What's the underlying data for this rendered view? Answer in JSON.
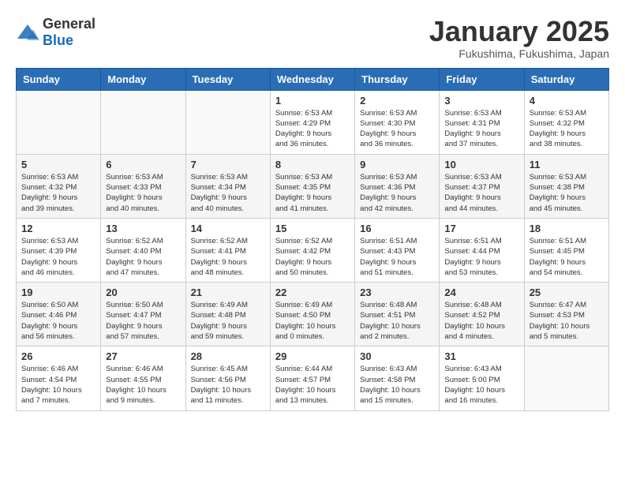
{
  "logo": {
    "general": "General",
    "blue": "Blue"
  },
  "title": "January 2025",
  "subtitle": "Fukushima, Fukushima, Japan",
  "days_of_week": [
    "Sunday",
    "Monday",
    "Tuesday",
    "Wednesday",
    "Thursday",
    "Friday",
    "Saturday"
  ],
  "weeks": [
    [
      {
        "day": "",
        "info": ""
      },
      {
        "day": "",
        "info": ""
      },
      {
        "day": "",
        "info": ""
      },
      {
        "day": "1",
        "info": "Sunrise: 6:53 AM\nSunset: 4:29 PM\nDaylight: 9 hours\nand 36 minutes."
      },
      {
        "day": "2",
        "info": "Sunrise: 6:53 AM\nSunset: 4:30 PM\nDaylight: 9 hours\nand 36 minutes."
      },
      {
        "day": "3",
        "info": "Sunrise: 6:53 AM\nSunset: 4:31 PM\nDaylight: 9 hours\nand 37 minutes."
      },
      {
        "day": "4",
        "info": "Sunrise: 6:53 AM\nSunset: 4:32 PM\nDaylight: 9 hours\nand 38 minutes."
      }
    ],
    [
      {
        "day": "5",
        "info": "Sunrise: 6:53 AM\nSunset: 4:32 PM\nDaylight: 9 hours\nand 39 minutes."
      },
      {
        "day": "6",
        "info": "Sunrise: 6:53 AM\nSunset: 4:33 PM\nDaylight: 9 hours\nand 40 minutes."
      },
      {
        "day": "7",
        "info": "Sunrise: 6:53 AM\nSunset: 4:34 PM\nDaylight: 9 hours\nand 40 minutes."
      },
      {
        "day": "8",
        "info": "Sunrise: 6:53 AM\nSunset: 4:35 PM\nDaylight: 9 hours\nand 41 minutes."
      },
      {
        "day": "9",
        "info": "Sunrise: 6:53 AM\nSunset: 4:36 PM\nDaylight: 9 hours\nand 42 minutes."
      },
      {
        "day": "10",
        "info": "Sunrise: 6:53 AM\nSunset: 4:37 PM\nDaylight: 9 hours\nand 44 minutes."
      },
      {
        "day": "11",
        "info": "Sunrise: 6:53 AM\nSunset: 4:38 PM\nDaylight: 9 hours\nand 45 minutes."
      }
    ],
    [
      {
        "day": "12",
        "info": "Sunrise: 6:53 AM\nSunset: 4:39 PM\nDaylight: 9 hours\nand 46 minutes."
      },
      {
        "day": "13",
        "info": "Sunrise: 6:52 AM\nSunset: 4:40 PM\nDaylight: 9 hours\nand 47 minutes."
      },
      {
        "day": "14",
        "info": "Sunrise: 6:52 AM\nSunset: 4:41 PM\nDaylight: 9 hours\nand 48 minutes."
      },
      {
        "day": "15",
        "info": "Sunrise: 6:52 AM\nSunset: 4:42 PM\nDaylight: 9 hours\nand 50 minutes."
      },
      {
        "day": "16",
        "info": "Sunrise: 6:51 AM\nSunset: 4:43 PM\nDaylight: 9 hours\nand 51 minutes."
      },
      {
        "day": "17",
        "info": "Sunrise: 6:51 AM\nSunset: 4:44 PM\nDaylight: 9 hours\nand 53 minutes."
      },
      {
        "day": "18",
        "info": "Sunrise: 6:51 AM\nSunset: 4:45 PM\nDaylight: 9 hours\nand 54 minutes."
      }
    ],
    [
      {
        "day": "19",
        "info": "Sunrise: 6:50 AM\nSunset: 4:46 PM\nDaylight: 9 hours\nand 56 minutes."
      },
      {
        "day": "20",
        "info": "Sunrise: 6:50 AM\nSunset: 4:47 PM\nDaylight: 9 hours\nand 57 minutes."
      },
      {
        "day": "21",
        "info": "Sunrise: 6:49 AM\nSunset: 4:48 PM\nDaylight: 9 hours\nand 59 minutes."
      },
      {
        "day": "22",
        "info": "Sunrise: 6:49 AM\nSunset: 4:50 PM\nDaylight: 10 hours\nand 0 minutes."
      },
      {
        "day": "23",
        "info": "Sunrise: 6:48 AM\nSunset: 4:51 PM\nDaylight: 10 hours\nand 2 minutes."
      },
      {
        "day": "24",
        "info": "Sunrise: 6:48 AM\nSunset: 4:52 PM\nDaylight: 10 hours\nand 4 minutes."
      },
      {
        "day": "25",
        "info": "Sunrise: 6:47 AM\nSunset: 4:53 PM\nDaylight: 10 hours\nand 5 minutes."
      }
    ],
    [
      {
        "day": "26",
        "info": "Sunrise: 6:46 AM\nSunset: 4:54 PM\nDaylight: 10 hours\nand 7 minutes."
      },
      {
        "day": "27",
        "info": "Sunrise: 6:46 AM\nSunset: 4:55 PM\nDaylight: 10 hours\nand 9 minutes."
      },
      {
        "day": "28",
        "info": "Sunrise: 6:45 AM\nSunset: 4:56 PM\nDaylight: 10 hours\nand 11 minutes."
      },
      {
        "day": "29",
        "info": "Sunrise: 6:44 AM\nSunset: 4:57 PM\nDaylight: 10 hours\nand 13 minutes."
      },
      {
        "day": "30",
        "info": "Sunrise: 6:43 AM\nSunset: 4:58 PM\nDaylight: 10 hours\nand 15 minutes."
      },
      {
        "day": "31",
        "info": "Sunrise: 6:43 AM\nSunset: 5:00 PM\nDaylight: 10 hours\nand 16 minutes."
      },
      {
        "day": "",
        "info": ""
      }
    ]
  ]
}
